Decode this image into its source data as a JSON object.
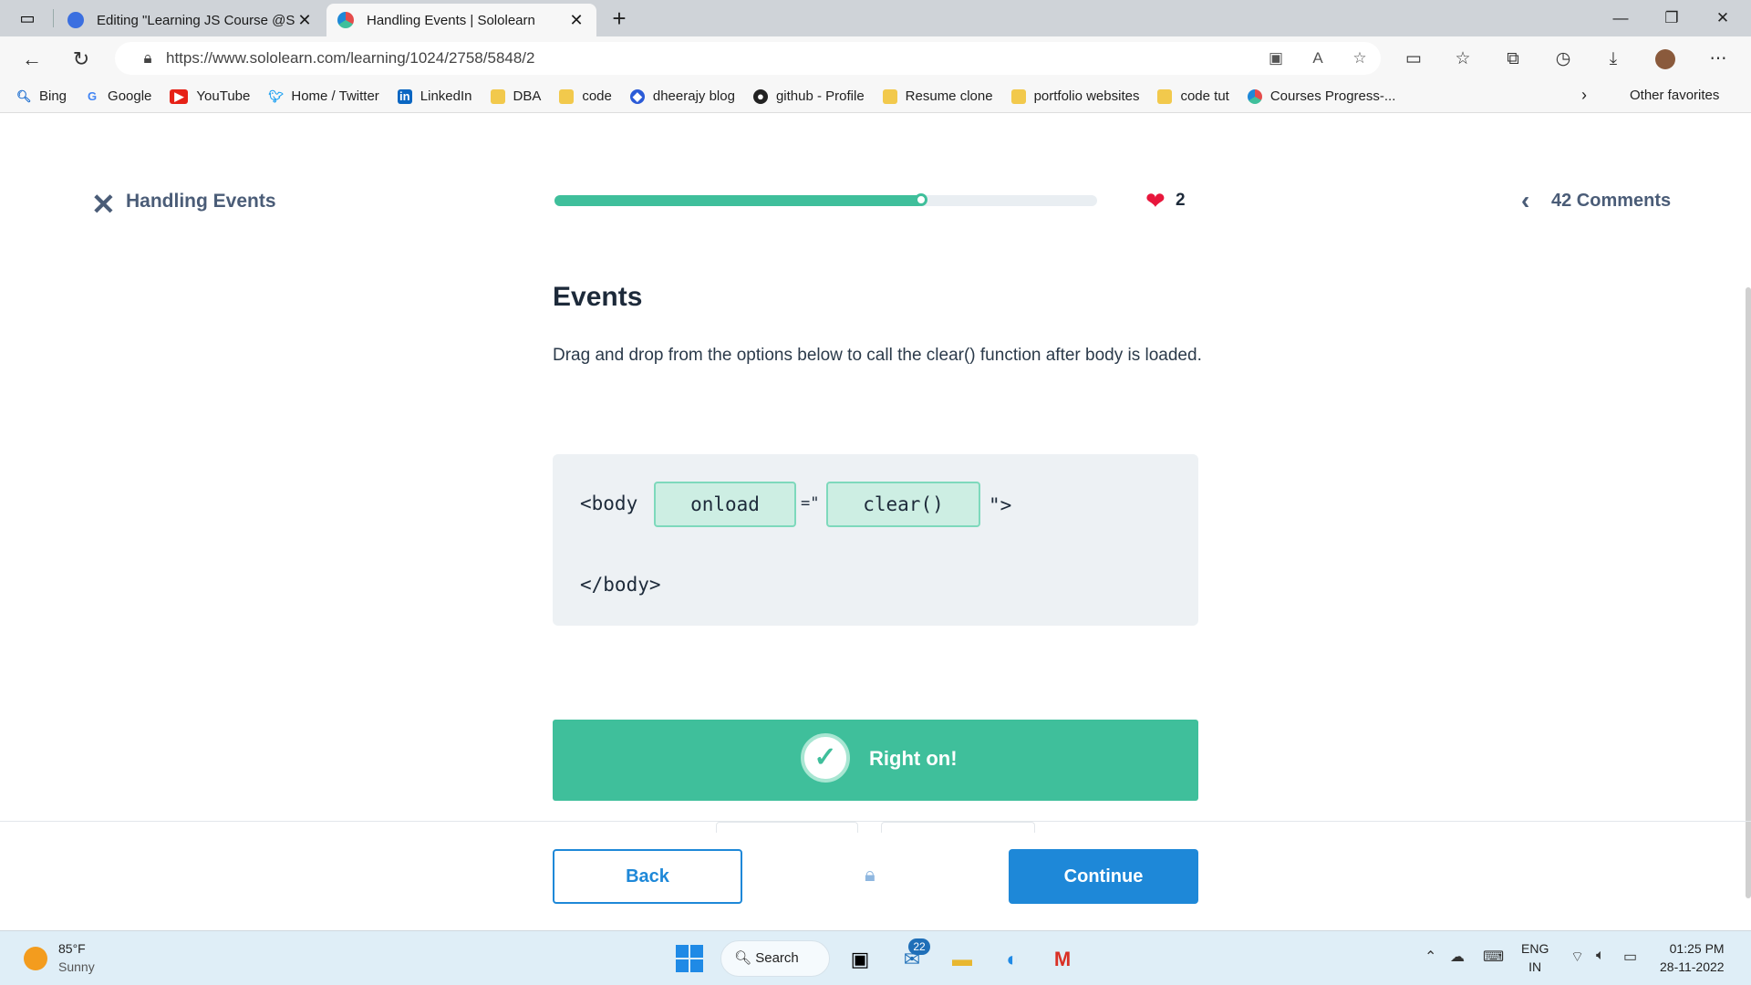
{
  "browser": {
    "tabs": [
      {
        "label": "Editing \"Learning JS Course @So",
        "active": false
      },
      {
        "label": "Handling Events | Sololearn",
        "active": true
      }
    ],
    "url": "https://www.sololearn.com/learning/1024/2758/5848/2",
    "bookmarks": [
      {
        "label": "Bing",
        "icon": "search-icon"
      },
      {
        "label": "Google",
        "icon": "google-icon"
      },
      {
        "label": "YouTube",
        "icon": "youtube-icon"
      },
      {
        "label": "Home / Twitter",
        "icon": "twitter-icon"
      },
      {
        "label": "LinkedIn",
        "icon": "linkedin-icon"
      },
      {
        "label": "DBA",
        "icon": "folder-icon"
      },
      {
        "label": "code",
        "icon": "folder-icon"
      },
      {
        "label": "dheerajy blog",
        "icon": "blog-icon"
      },
      {
        "label": "github - Profile",
        "icon": "github-icon"
      },
      {
        "label": "Resume clone",
        "icon": "folder-icon"
      },
      {
        "label": "portfolio websites",
        "icon": "folder-icon"
      },
      {
        "label": "code tut",
        "icon": "folder-icon"
      },
      {
        "label": "Courses Progress-...",
        "icon": "sololearn-icon"
      }
    ],
    "other_favorites": "Other favorites"
  },
  "lesson": {
    "title": "Handling Events",
    "progress": 0.68,
    "lives": "2",
    "comments": "42 Comments",
    "heading": "Events",
    "instruction": "Drag and drop from the options below to call the clear() function after body is loaded.",
    "code": {
      "open_tag": "<body",
      "slot1": "onload",
      "equals": "=\"",
      "slot2": "clear()",
      "close_quote": "\">",
      "close_tag": "</body>"
    },
    "feedback": "Right on!",
    "back_label": "Back",
    "continue_label": "Continue"
  },
  "taskbar": {
    "temp": "85°F",
    "weather": "Sunny",
    "search": "Search",
    "mail_badge": "22",
    "lang_line1": "ENG",
    "lang_line2": "IN",
    "time": "01:25 PM",
    "date": "28-11-2022"
  },
  "colors": {
    "accent_green": "#3fbf9b",
    "accent_blue": "#1e88d8",
    "heart_red": "#e8173c"
  }
}
